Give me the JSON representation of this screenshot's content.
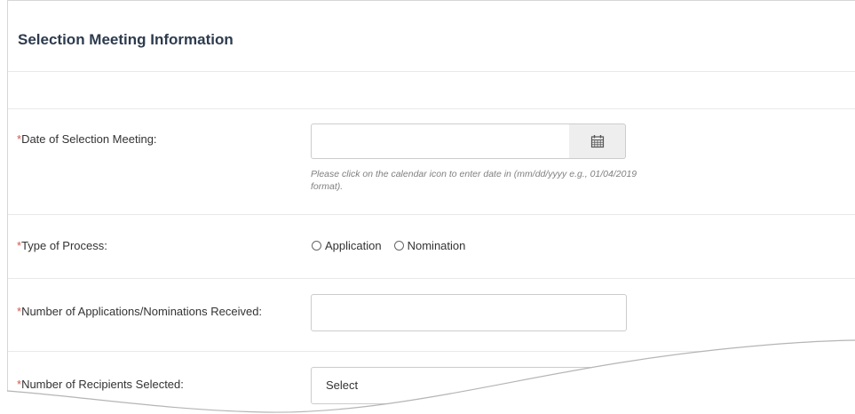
{
  "section": {
    "title": "Selection Meeting Information"
  },
  "fields": {
    "date": {
      "required_mark": "*",
      "label": "Date of Selection Meeting:",
      "value": "",
      "help": "Please click on the calendar icon to enter date in (mm/dd/yyyy e.g., 01/04/2019 format).",
      "icon": "calendar-icon"
    },
    "process": {
      "required_mark": "*",
      "label": "Type of Process:",
      "options": [
        "Application",
        "Nomination"
      ]
    },
    "received": {
      "required_mark": "*",
      "label": "Number of Applications/Nominations Received:",
      "value": ""
    },
    "recipients": {
      "required_mark": "*",
      "label": "Number of Recipients Selected:",
      "selected": "Select"
    }
  },
  "colors": {
    "required": "#d9534f",
    "title": "#2d3b4e",
    "border": "#cccccc"
  }
}
